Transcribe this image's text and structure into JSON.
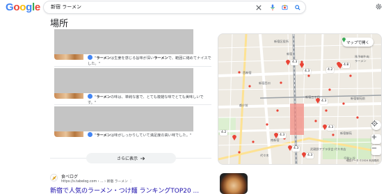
{
  "header": {
    "logo": [
      "G",
      "o",
      "o",
      "g",
      "l",
      "e"
    ],
    "logo_colors": [
      "#4285f4",
      "#ea4335",
      "#fbbc05",
      "#4285f4",
      "#34a853",
      "#ea4335"
    ],
    "query": "新宿 ラーメン"
  },
  "section_title": "場所",
  "results": [
    {
      "review_prefix": "\"",
      "review_bold1": "ラーメン",
      "review_mid": "は生姜を感じる旨味が深い",
      "review_bold2": "ラーメン",
      "review_end": "で、範囲に絡めてナイスでした。\""
    },
    {
      "review_prefix": "\"",
      "review_bold1": "ラーメン",
      "review_mid": "の味は、単純な客で、とても複雑な味でとても美味しいです。\"",
      "review_bold2": "",
      "review_end": ""
    },
    {
      "review_prefix": "\"",
      "review_bold1": "ラーメン",
      "review_mid": "は味がしっかりしていて満足度の高い味でした。\"",
      "review_bold2": "",
      "review_end": ""
    }
  ],
  "more_button": "さらに表示",
  "organic": {
    "site_name": "食べログ",
    "site_url": "https://s.tabelog.com › ... › 新宿 ラーメン",
    "dots": "⋮",
    "title": "新宿で人気のラーメン・つけ麺 ランキングTOP20 ..."
  },
  "map": {
    "open_button": "マップで開く",
    "footer": "地図データ ©2024 利用規約",
    "labels": [
      {
        "text": "新宿区役所",
        "cls": "a1"
      },
      {
        "text": "新宿",
        "cls": "a2"
      },
      {
        "text": "西新宿",
        "cls": "a3"
      },
      {
        "text": "新宿西口",
        "cls": "a4"
      },
      {
        "text": "新宿三丁目",
        "cls": "a5"
      },
      {
        "text": "馬予喇牛肉",
        "cls": "a6"
      },
      {
        "text": "ラーメン",
        "cls": "a7"
      },
      {
        "text": "新宿御苑前",
        "cls": "a8"
      },
      {
        "text": "都庁前",
        "cls": "a9"
      },
      {
        "text": "南新宿",
        "cls": "a10"
      },
      {
        "text": "代々木",
        "cls": "a11"
      },
      {
        "text": "武蔵野アブラ学会 代々木店",
        "cls": "a12"
      },
      {
        "text": "新宿御苑",
        "cls": "a13"
      },
      {
        "text": "千駄ヶ谷",
        "cls": "a14"
      }
    ],
    "ratings": [
      "4.3",
      "4.3",
      "4.2",
      "4.8",
      "4.3",
      "4.3",
      "4.3",
      "4.3",
      "4.3",
      "4.2"
    ]
  },
  "colors": {
    "link": "#1a0dab",
    "map_pin": "#ea4335",
    "map_bg": "#eeeae2",
    "road": "#ffffff",
    "rail": "#9aa0a6"
  }
}
